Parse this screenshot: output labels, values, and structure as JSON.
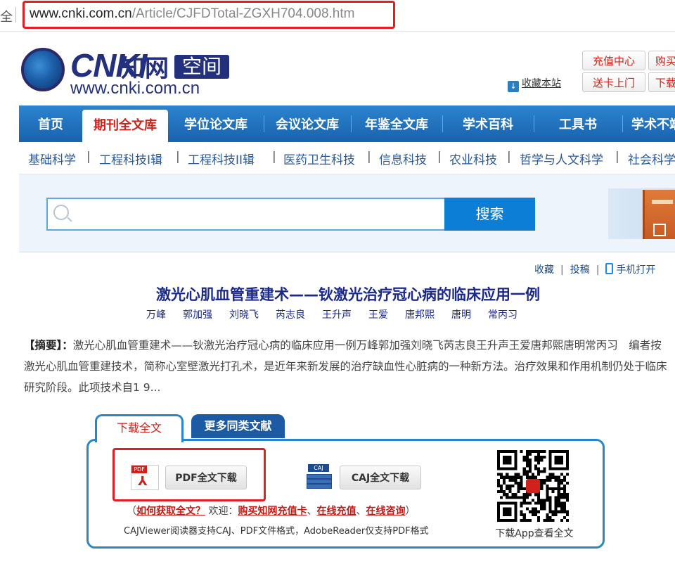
{
  "browser": {
    "left_fragment": "全",
    "url_host": "www.cnki.com.cn",
    "url_path": "/Article/CJFDTotal-ZGXH704.008.htm"
  },
  "logo": {
    "brand": "CNKI",
    "cn": "知网",
    "zone": "空间",
    "url": "www.cnki.com.cn"
  },
  "top_buttons": [
    "充值中心",
    "购买",
    "送卡上门",
    "下载"
  ],
  "fav_site": "收藏本站",
  "nav": {
    "items": [
      "首页",
      "期刊全文库",
      "学位论文库",
      "会议论文库",
      "年鉴全文库",
      "学术百科",
      "工具书",
      "学术不端"
    ],
    "active_index": 1
  },
  "subnav": [
    "基础科学",
    "工程科技I辑",
    "工程科技II辑",
    "医药卫生科技",
    "信息科技",
    "农业科技",
    "哲学与人文科学",
    "社会科学"
  ],
  "search": {
    "placeholder": "",
    "button": "搜索"
  },
  "actions": {
    "collect": "收藏",
    "submit": "投稿",
    "mobile": "手机打开"
  },
  "article": {
    "title": "激光心肌血管重建术——钬激光治疗冠心病的临床应用一例",
    "authors": [
      "万峰",
      "郭加强",
      "刘晓飞",
      "芮志良",
      "王升声",
      "王爱",
      "唐邦熙",
      "唐明",
      "常丙习"
    ],
    "abstract_label": "【摘要】：",
    "abstract": "激光心肌血管重建术——钬激光治疗冠心病的临床应用一例万峰郭加强刘晓飞芮志良王升声王爱唐邦熙唐明常丙习　编者按激光心肌血管重建技术，简称心室壁激光打孔术，是近年来新发展的治疗缺血性心脏病的一种新方法。治疗效果和作用机制仍处于临床研究阶段。此项技术自1 9..."
  },
  "download": {
    "tab_active": "下载全文",
    "tab_other": "更多同类文献",
    "pdf_icon_tag": "PDF",
    "pdf_button": "PDF全文下载",
    "caj_icon_tag": "CAJ",
    "caj_button": "CAJ全文下载",
    "links_open": "（",
    "how_to": "如何获取全文？",
    "welcome": " 欢迎：",
    "buy_card": "购买知网充值卡",
    "comma1": "、",
    "recharge": "在线充值",
    "comma2": "、",
    "consult": "在线咨询",
    "links_close": "）",
    "formats": "CAJViewer阅读器支持CAJ、PDF文件格式，AdobeReader仅支持PDF格式",
    "qr_label": "下载App查看全文"
  },
  "colors": {
    "nav_blue": "#1962ad",
    "accent_red": "#d0221b",
    "title_blue": "#1b2a8a",
    "search_blue": "#0c7ed6"
  }
}
